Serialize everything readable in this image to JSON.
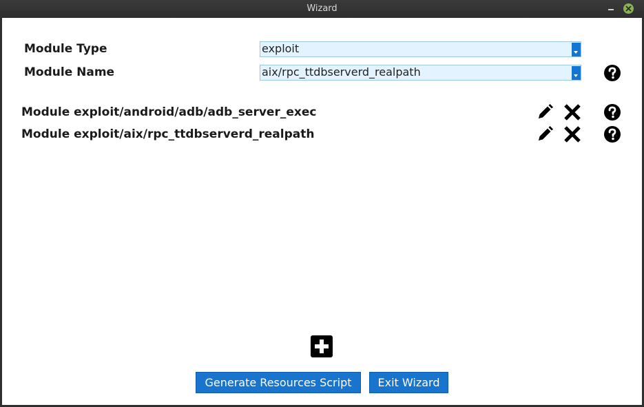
{
  "window": {
    "title": "Wizard"
  },
  "form": {
    "module_type_label": "Module Type",
    "module_type_value": "exploit",
    "module_name_label": "Module Name",
    "module_name_value": "aix/rpc_ttdbserverd_realpath"
  },
  "modules": [
    {
      "label": "Module exploit/android/adb/adb_server_exec"
    },
    {
      "label": "Module exploit/aix/rpc_ttdbserverd_realpath"
    }
  ],
  "buttons": {
    "generate": "Generate Resources Script",
    "exit": "Exit Wizard"
  },
  "icons": {
    "edit": "pencil-icon",
    "remove": "close-x-icon",
    "help": "question-circle-icon",
    "add": "plus-square-icon"
  },
  "colors": {
    "accent": "#1874cd",
    "combo_bg": "#e3f3ff",
    "titlebar": "#2f2f2f",
    "close_green": "#8bb158"
  }
}
